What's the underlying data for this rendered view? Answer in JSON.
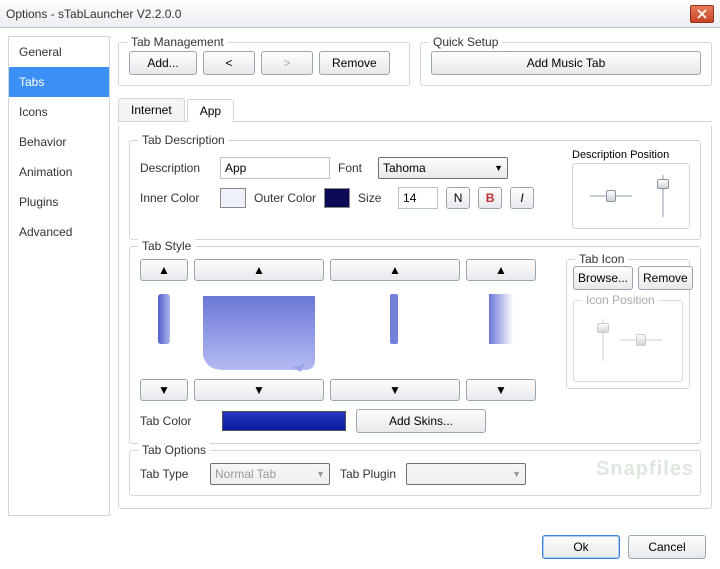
{
  "window": {
    "title": "Options - sTabLauncher V2.2.0.0"
  },
  "sidebar": {
    "items": [
      {
        "label": "General"
      },
      {
        "label": "Tabs",
        "selected": true
      },
      {
        "label": "Icons"
      },
      {
        "label": "Behavior"
      },
      {
        "label": "Animation"
      },
      {
        "label": "Plugins"
      },
      {
        "label": "Advanced"
      }
    ]
  },
  "tabManagement": {
    "title": "Tab Management",
    "add": "Add...",
    "prev": "<",
    "next": ">",
    "remove": "Remove"
  },
  "quickSetup": {
    "title": "Quick Setup",
    "addMusic": "Add Music Tab"
  },
  "subtabs": {
    "items": [
      {
        "label": "Internet"
      },
      {
        "label": "App",
        "active": true
      }
    ]
  },
  "tabDescription": {
    "title": "Tab Description",
    "description_lbl": "Description",
    "description_val": "App",
    "font_lbl": "Font",
    "font_val": "Tahoma",
    "inner_lbl": "Inner Color",
    "outer_lbl": "Outer Color",
    "size_lbl": "Size",
    "size_val": "14",
    "fmt_n": "N",
    "fmt_b": "B",
    "fmt_i": "I",
    "position_title": "Description Position"
  },
  "tabStyle": {
    "title": "Tab Style",
    "tabcolor_lbl": "Tab Color",
    "addskins": "Add Skins...",
    "tabicon_title": "Tab Icon",
    "browse": "Browse...",
    "remove": "Remove",
    "iconpos_title": "Icon Position",
    "arrow_up": "▲",
    "arrow_down": "▼"
  },
  "tabOptions": {
    "title": "Tab Options",
    "tabtype_lbl": "Tab Type",
    "tabtype_val": "Normal Tab",
    "tabplugin_lbl": "Tab Plugin",
    "tabplugin_val": ""
  },
  "footer": {
    "ok": "Ok",
    "cancel": "Cancel"
  },
  "watermark": "Snapfiles"
}
